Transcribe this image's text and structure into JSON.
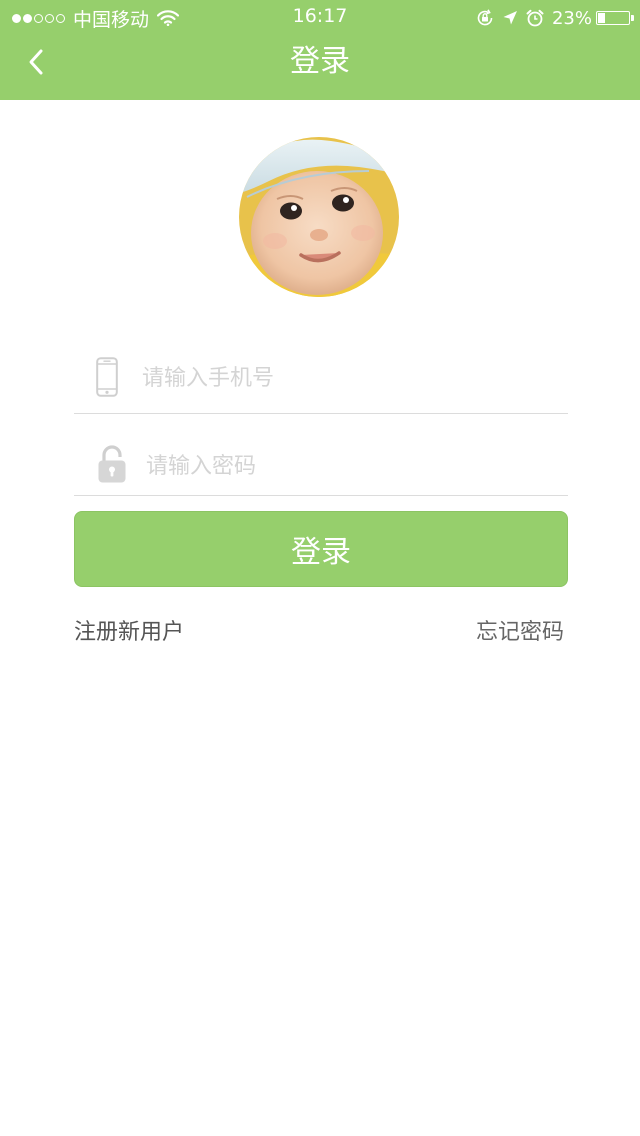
{
  "status_bar": {
    "signal_dots_filled": 2,
    "signal_dots_total": 5,
    "carrier": "中国移动",
    "time": "16:17",
    "battery_percent": "23%",
    "battery_level": 0.23,
    "icons": [
      "wifi-icon",
      "rotation-lock-icon",
      "location-arrow-icon",
      "alarm-clock-icon",
      "battery-icon"
    ]
  },
  "navbar": {
    "title": "登录",
    "back_icon": "chevron-left-icon"
  },
  "avatar": {
    "icon": "baby-avatar-photo"
  },
  "form": {
    "phone": {
      "icon": "phone-icon",
      "placeholder": "请输入手机号",
      "value": ""
    },
    "password": {
      "icon": "lock-icon",
      "placeholder": "请输入密码",
      "value": ""
    },
    "login_button_label": "登录"
  },
  "links": {
    "register": "注册新用户",
    "forgot_password": "忘记密码"
  },
  "colors": {
    "accent": "#96cf6c",
    "divider": "#dcdcdc",
    "placeholder": "#d4d4d4",
    "link_text": "#555555"
  }
}
